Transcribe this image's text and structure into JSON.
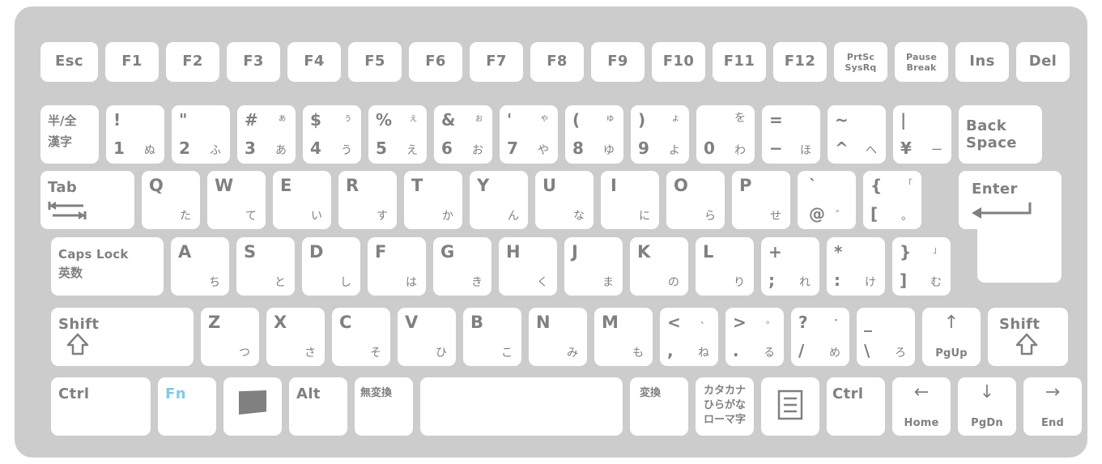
{
  "device": {
    "name": "japanese-jis-laptop-keyboard",
    "body_color": "#cccccc",
    "key_color": "#ffffff",
    "legend_color": "#808080",
    "fn_accent_color": "#82c8e3"
  },
  "rows": {
    "function_row": [
      {
        "id": "esc",
        "main": "Esc"
      },
      {
        "id": "f1",
        "main": "F1"
      },
      {
        "id": "f2",
        "main": "F2"
      },
      {
        "id": "f3",
        "main": "F3"
      },
      {
        "id": "f4",
        "main": "F4"
      },
      {
        "id": "f5",
        "main": "F5"
      },
      {
        "id": "f6",
        "main": "F6"
      },
      {
        "id": "f7",
        "main": "F7"
      },
      {
        "id": "f8",
        "main": "F8"
      },
      {
        "id": "f9",
        "main": "F9"
      },
      {
        "id": "f10",
        "main": "F10"
      },
      {
        "id": "f11",
        "main": "F11"
      },
      {
        "id": "f12",
        "main": "F12"
      },
      {
        "id": "prtsc",
        "line1": "PrtSc",
        "line2": "SysRq"
      },
      {
        "id": "pause",
        "line1": "Pause",
        "line2": "Break"
      },
      {
        "id": "ins",
        "main": "Ins"
      },
      {
        "id": "del",
        "main": "Del"
      }
    ],
    "number_row": [
      {
        "id": "hankaku",
        "line1": "半/全",
        "line2": "漢字"
      },
      {
        "id": "digit1",
        "sym": "!",
        "num": "1",
        "kana": "ぬ"
      },
      {
        "id": "digit2",
        "sym": "\"",
        "num": "2",
        "kana": "ふ"
      },
      {
        "id": "digit3",
        "sym": "#",
        "kana_small": "ぁ",
        "num": "3",
        "kana": "あ"
      },
      {
        "id": "digit4",
        "sym": "$",
        "kana_small": "ぅ",
        "num": "4",
        "kana": "う"
      },
      {
        "id": "digit5",
        "sym": "%",
        "kana_small": "ぇ",
        "num": "5",
        "kana": "え"
      },
      {
        "id": "digit6",
        "sym": "&",
        "kana_small": "ぉ",
        "num": "6",
        "kana": "お"
      },
      {
        "id": "digit7",
        "sym": "'",
        "kana_small": "ゃ",
        "num": "7",
        "kana": "や"
      },
      {
        "id": "digit8",
        "sym": "(",
        "kana_small": "ゅ",
        "num": "8",
        "kana": "ゆ"
      },
      {
        "id": "digit9",
        "sym": ")",
        "kana_small": "ょ",
        "num": "9",
        "kana": "よ"
      },
      {
        "id": "digit0",
        "kana_small": "を",
        "num": "0",
        "kana": "わ"
      },
      {
        "id": "minus",
        "sym": "=",
        "num": "−",
        "kana": "ほ"
      },
      {
        "id": "caret",
        "sym": "~",
        "num": "^",
        "kana": "へ"
      },
      {
        "id": "yen",
        "sym": "|",
        "num": "¥",
        "kana": "ー"
      },
      {
        "id": "backspace",
        "line1": "Back",
        "line2": "Space"
      }
    ],
    "qwerty_row": [
      {
        "id": "tab",
        "main": "Tab",
        "icon": "tab-arrows-icon"
      },
      {
        "id": "q",
        "lat": "Q",
        "kana": "た"
      },
      {
        "id": "w",
        "lat": "W",
        "kana": "て"
      },
      {
        "id": "e",
        "lat": "E",
        "kana": "い"
      },
      {
        "id": "r",
        "lat": "R",
        "kana": "す"
      },
      {
        "id": "t",
        "lat": "T",
        "kana": "か"
      },
      {
        "id": "y",
        "lat": "Y",
        "kana": "ん"
      },
      {
        "id": "u",
        "lat": "U",
        "kana": "な"
      },
      {
        "id": "i",
        "lat": "I",
        "kana": "に"
      },
      {
        "id": "o",
        "lat": "O",
        "kana": "ら"
      },
      {
        "id": "p",
        "lat": "P",
        "kana": "せ"
      },
      {
        "id": "at",
        "sym": "`",
        "num": "@",
        "kana": "゛"
      },
      {
        "id": "bracketleft",
        "sym": "{",
        "kana_small": "「",
        "num": "[",
        "kana": "。"
      },
      {
        "id": "enter",
        "main": "Enter",
        "icon": "enter-arrow-icon"
      }
    ],
    "home_row": [
      {
        "id": "capslock",
        "line1": "Caps Lock",
        "line2": "英数"
      },
      {
        "id": "a",
        "lat": "A",
        "kana": "ち"
      },
      {
        "id": "s",
        "lat": "S",
        "kana": "と"
      },
      {
        "id": "d",
        "lat": "D",
        "kana": "し"
      },
      {
        "id": "f",
        "lat": "F",
        "kana": "は"
      },
      {
        "id": "g",
        "lat": "G",
        "kana": "き"
      },
      {
        "id": "h",
        "lat": "H",
        "kana": "く"
      },
      {
        "id": "j",
        "lat": "J",
        "kana": "ま"
      },
      {
        "id": "k",
        "lat": "K",
        "kana": "の"
      },
      {
        "id": "l",
        "lat": "L",
        "kana": "り"
      },
      {
        "id": "semicolon",
        "sym": "+",
        "num": ";",
        "kana": "れ"
      },
      {
        "id": "colon",
        "sym": "*",
        "num": ":",
        "kana": "け"
      },
      {
        "id": "bracketright",
        "sym": "}",
        "kana_small": "」",
        "num": "]",
        "kana": "む"
      }
    ],
    "shift_row": [
      {
        "id": "lshift",
        "main": "Shift",
        "icon": "shift-up-arrow-icon"
      },
      {
        "id": "z",
        "lat": "Z",
        "kana": "つ"
      },
      {
        "id": "x",
        "lat": "X",
        "kana": "さ"
      },
      {
        "id": "c",
        "lat": "C",
        "kana": "そ"
      },
      {
        "id": "v",
        "lat": "V",
        "kana": "ひ"
      },
      {
        "id": "b",
        "lat": "B",
        "kana": "こ"
      },
      {
        "id": "n",
        "lat": "N",
        "kana": "み"
      },
      {
        "id": "m",
        "lat": "M",
        "kana": "も"
      },
      {
        "id": "comma",
        "sym": "<",
        "kana_small": "、",
        "num": ",",
        "kana": "ね"
      },
      {
        "id": "period",
        "sym": ">",
        "kana_small": "。",
        "num": ".",
        "kana": "る"
      },
      {
        "id": "slash",
        "sym": "?",
        "kana_small": "・",
        "num": "/",
        "kana": "め"
      },
      {
        "id": "backslash",
        "sym": "_",
        "num": "\\",
        "kana": "ろ"
      },
      {
        "id": "up",
        "arrow": "↑",
        "nav": "PgUp"
      },
      {
        "id": "rshift",
        "main": "Shift",
        "icon": "shift-up-arrow-icon"
      }
    ],
    "bottom_row": [
      {
        "id": "lctrl",
        "main": "Ctrl"
      },
      {
        "id": "fn",
        "main": "Fn",
        "accent": true
      },
      {
        "id": "win",
        "icon": "windows-logo-icon"
      },
      {
        "id": "alt",
        "main": "Alt"
      },
      {
        "id": "muhenkan",
        "main": "無変換"
      },
      {
        "id": "space",
        "main": ""
      },
      {
        "id": "henkan",
        "main": "変換"
      },
      {
        "id": "katakana",
        "line1": "カタカナ",
        "line2": "ひらがな",
        "line3": "ローマ字"
      },
      {
        "id": "menu",
        "icon": "menu-document-icon"
      },
      {
        "id": "rctrl",
        "main": "Ctrl"
      },
      {
        "id": "left",
        "arrow": "←",
        "nav": "Home"
      },
      {
        "id": "down",
        "arrow": "↓",
        "nav": "PgDn"
      },
      {
        "id": "right",
        "arrow": "→",
        "nav": "End"
      }
    ]
  }
}
